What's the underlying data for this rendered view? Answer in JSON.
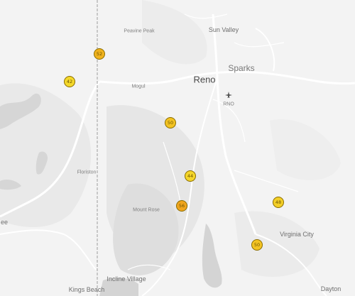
{
  "map": {
    "labels": {
      "peavine_peak": "Peavine Peak",
      "sun_valley": "Sun Valley",
      "reno": "Reno",
      "sparks": "Sparks",
      "mogul": "Mogul",
      "rno": "RNO",
      "floriston": "Floriston",
      "mount_rose": "Mount Rose",
      "virginia_city": "Virginia City",
      "incline_village": "Incline Village",
      "kings_beach": "Kings Beach",
      "dayton": "Dayton",
      "truckee_partial": "ee"
    },
    "markers": [
      {
        "value": "52",
        "color": "#f0b21d"
      },
      {
        "value": "42",
        "color": "#f4d82a"
      },
      {
        "value": "50",
        "color": "#f3c322"
      },
      {
        "value": "44",
        "color": "#f4d52a"
      },
      {
        "value": "56",
        "color": "#f0a51d"
      },
      {
        "value": "48",
        "color": "#f3cf27"
      },
      {
        "value": "50",
        "color": "#f3c322"
      }
    ]
  }
}
